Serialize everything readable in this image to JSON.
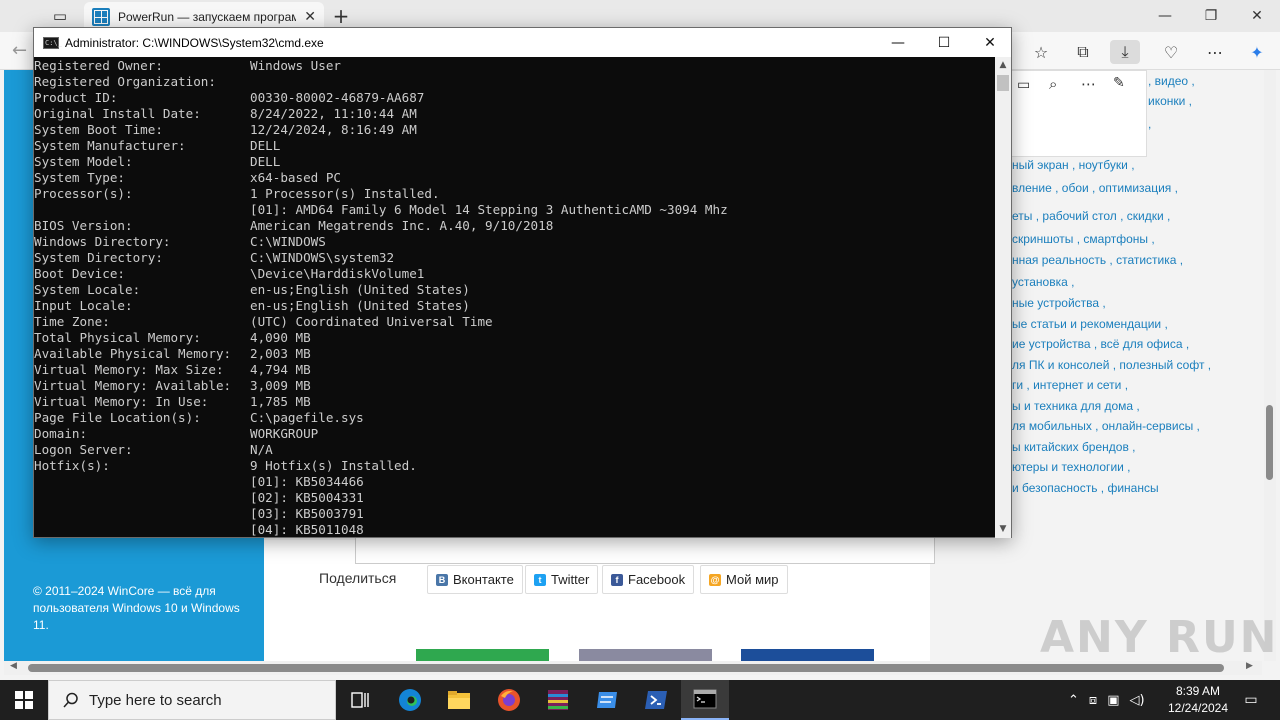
{
  "browser": {
    "tab_title": "PowerRun — запускаем програм",
    "tab_close": "✕",
    "new_tab": "+",
    "minimize": "—",
    "restore": "❐",
    "close": "✕"
  },
  "page": {
    "footer": "© 2011–2024 WinCore — всё для пользователя Windows 10 и Windows 11.",
    "share_label": "Поделиться",
    "share_buttons": [
      {
        "label": "Вконтакте",
        "icon": "vk-icon",
        "color": "#4a76a8"
      },
      {
        "label": "Twitter",
        "icon": "twitter-icon",
        "color": "#1da1f2"
      },
      {
        "label": "Facebook",
        "icon": "facebook-icon",
        "color": "#3b5998"
      },
      {
        "label": "Мой мир",
        "icon": "mymir-icon",
        "color": "#f5a623"
      }
    ],
    "tags": [
      ", видео ,",
      "иконки ,",
      ",",
      "ный экран , ноутбуки ,",
      "вление , обои , оптимизация ,",
      "еты , рабочий стол , скидки ,",
      "скриншоты , смартфоны ,",
      "нная реальность , статистика ,",
      "установка ,",
      "ные устройства ,",
      "ые статьи и рекомендации ,",
      "ие устройства , всё для офиса ,",
      "ля ПК и консолей , полезный софт ,",
      "ги , интернет и сети ,",
      "ы и техника для дома ,",
      "ля мобильных , онлайн-сервисы ,",
      "ы китайских брендов ,",
      "ютеры и технологии ,",
      "и безопасность , финансы"
    ],
    "watermark": "ANY RUN"
  },
  "cmd": {
    "title": "Administrator: C:\\WINDOWS\\System32\\cmd.exe",
    "icon_text": "C:\\_",
    "minimize": "—",
    "maximize": "☐",
    "close": "✕",
    "lines": [
      {
        "label": "Registered Owner:",
        "value": "Windows User"
      },
      {
        "label": "Registered Organization:",
        "value": ""
      },
      {
        "label": "Product ID:",
        "value": "00330-80002-46879-AA687"
      },
      {
        "label": "Original Install Date:",
        "value": "8/24/2022, 11:10:44 AM"
      },
      {
        "label": "System Boot Time:",
        "value": "12/24/2024, 8:16:49 AM"
      },
      {
        "label": "System Manufacturer:",
        "value": "DELL"
      },
      {
        "label": "System Model:",
        "value": "DELL"
      },
      {
        "label": "System Type:",
        "value": "x64-based PC"
      },
      {
        "label": "Processor(s):",
        "value": "1 Processor(s) Installed."
      },
      {
        "label": "",
        "value": "[01]: AMD64 Family 6 Model 14 Stepping 3 AuthenticAMD ~3094 Mhz"
      },
      {
        "label": "BIOS Version:",
        "value": "American Megatrends Inc. A.40, 9/10/2018"
      },
      {
        "label": "Windows Directory:",
        "value": "C:\\WINDOWS"
      },
      {
        "label": "System Directory:",
        "value": "C:\\WINDOWS\\system32"
      },
      {
        "label": "Boot Device:",
        "value": "\\Device\\HarddiskVolume1"
      },
      {
        "label": "System Locale:",
        "value": "en-us;English (United States)"
      },
      {
        "label": "Input Locale:",
        "value": "en-us;English (United States)"
      },
      {
        "label": "Time Zone:",
        "value": "(UTC) Coordinated Universal Time"
      },
      {
        "label": "Total Physical Memory:",
        "value": "4,090 MB"
      },
      {
        "label": "Available Physical Memory:",
        "value": "2,003 MB"
      },
      {
        "label": "Virtual Memory: Max Size:",
        "value": "4,794 MB"
      },
      {
        "label": "Virtual Memory: Available:",
        "value": "3,009 MB"
      },
      {
        "label": "Virtual Memory: In Use:",
        "value": "1,785 MB"
      },
      {
        "label": "Page File Location(s):",
        "value": "C:\\pagefile.sys"
      },
      {
        "label": "Domain:",
        "value": "WORKGROUP"
      },
      {
        "label": "Logon Server:",
        "value": "N/A"
      },
      {
        "label": "Hotfix(s):",
        "value": "9 Hotfix(s) Installed."
      },
      {
        "label": "",
        "value": "[01]: KB5034466"
      },
      {
        "label": "",
        "value": "[02]: KB5004331"
      },
      {
        "label": "",
        "value": "[03]: KB5003791"
      },
      {
        "label": "",
        "value": "[04]: KB5011048"
      }
    ]
  },
  "taskbar": {
    "search_placeholder": "Type here to search",
    "time": "8:39 AM",
    "date": "12/24/2024"
  }
}
